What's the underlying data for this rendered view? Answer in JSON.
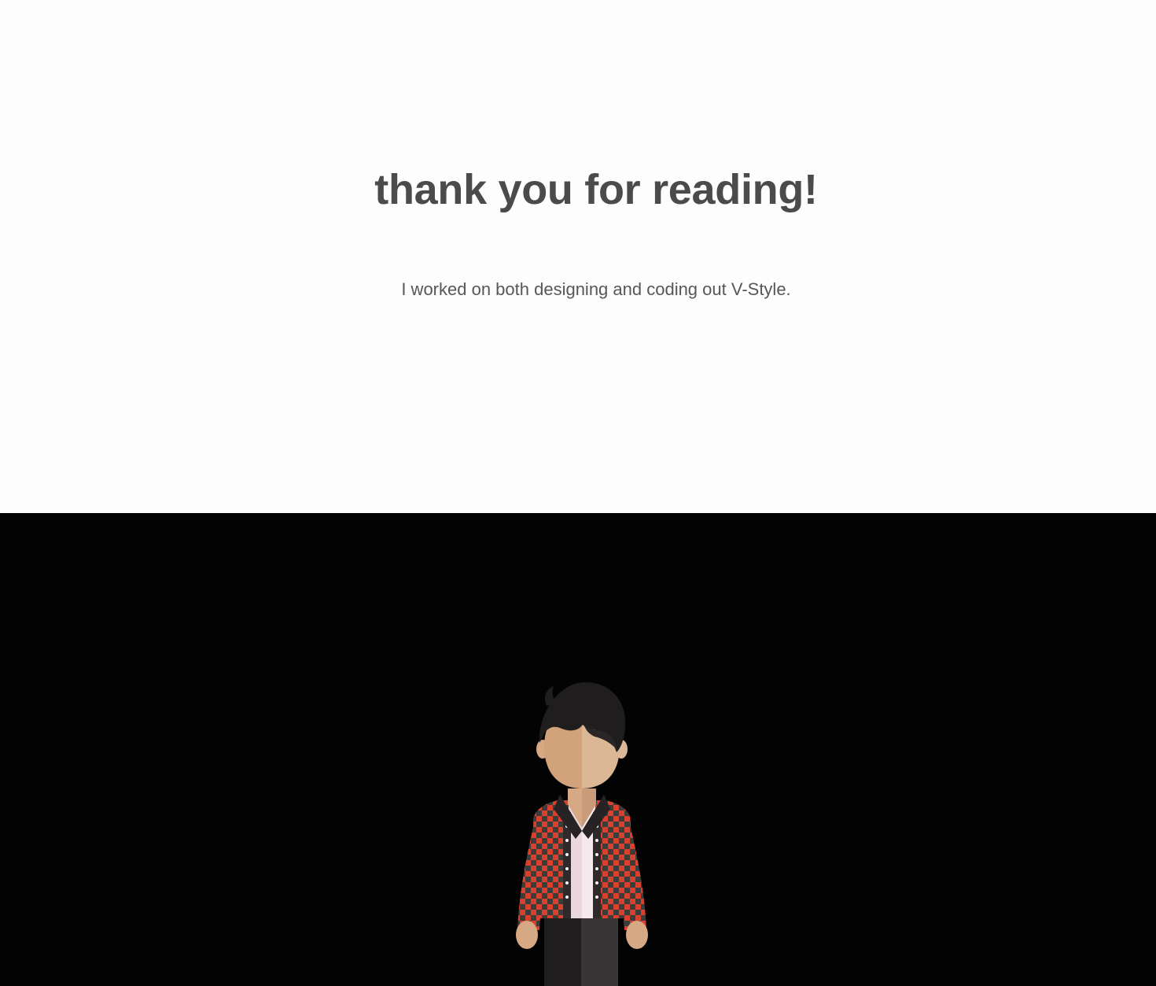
{
  "closing": {
    "headline": "thank you for reading!",
    "subtext": "I worked on both designing and coding out V-Style."
  },
  "colors": {
    "top_background": "#fdfdfd",
    "bottom_background": "#030303",
    "headline": "#4b4b4b",
    "subtext": "#575757",
    "shirt_red": "#d9402e",
    "shirt_dark": "#3a3d3a",
    "skin": "#d6a884",
    "hair": "#201d1e"
  },
  "illustration": {
    "subject": "avatar-character",
    "icon": "person-in-plaid-shirt-icon"
  }
}
